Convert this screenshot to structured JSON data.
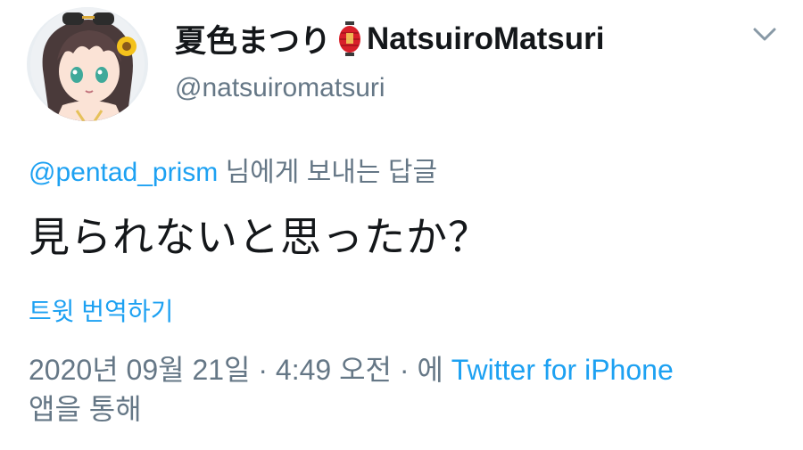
{
  "user": {
    "display_name": "夏色まつり",
    "display_name_en": "NatsuiroMatsuri",
    "emoji_icon": "red-paper-lantern-icon",
    "handle": "@natsuiromatsuri"
  },
  "reply": {
    "mention": "@pentad_prism",
    "suffix": " 님에게 보내는 답글"
  },
  "tweet": {
    "text": "見られないと思ったか？"
  },
  "translate_label": "트윗 번역하기",
  "meta": {
    "timestamp": "2020년 09월 21일 · 4:49 오전 · 에 ",
    "source": "Twitter for iPhone",
    "trailing": "앱을 통해"
  },
  "icons": {
    "menu": "chevron-down-icon",
    "avatar": "avatar"
  },
  "colors": {
    "link": "#1da1f2",
    "secondary": "#657786",
    "primary": "#14171a"
  }
}
